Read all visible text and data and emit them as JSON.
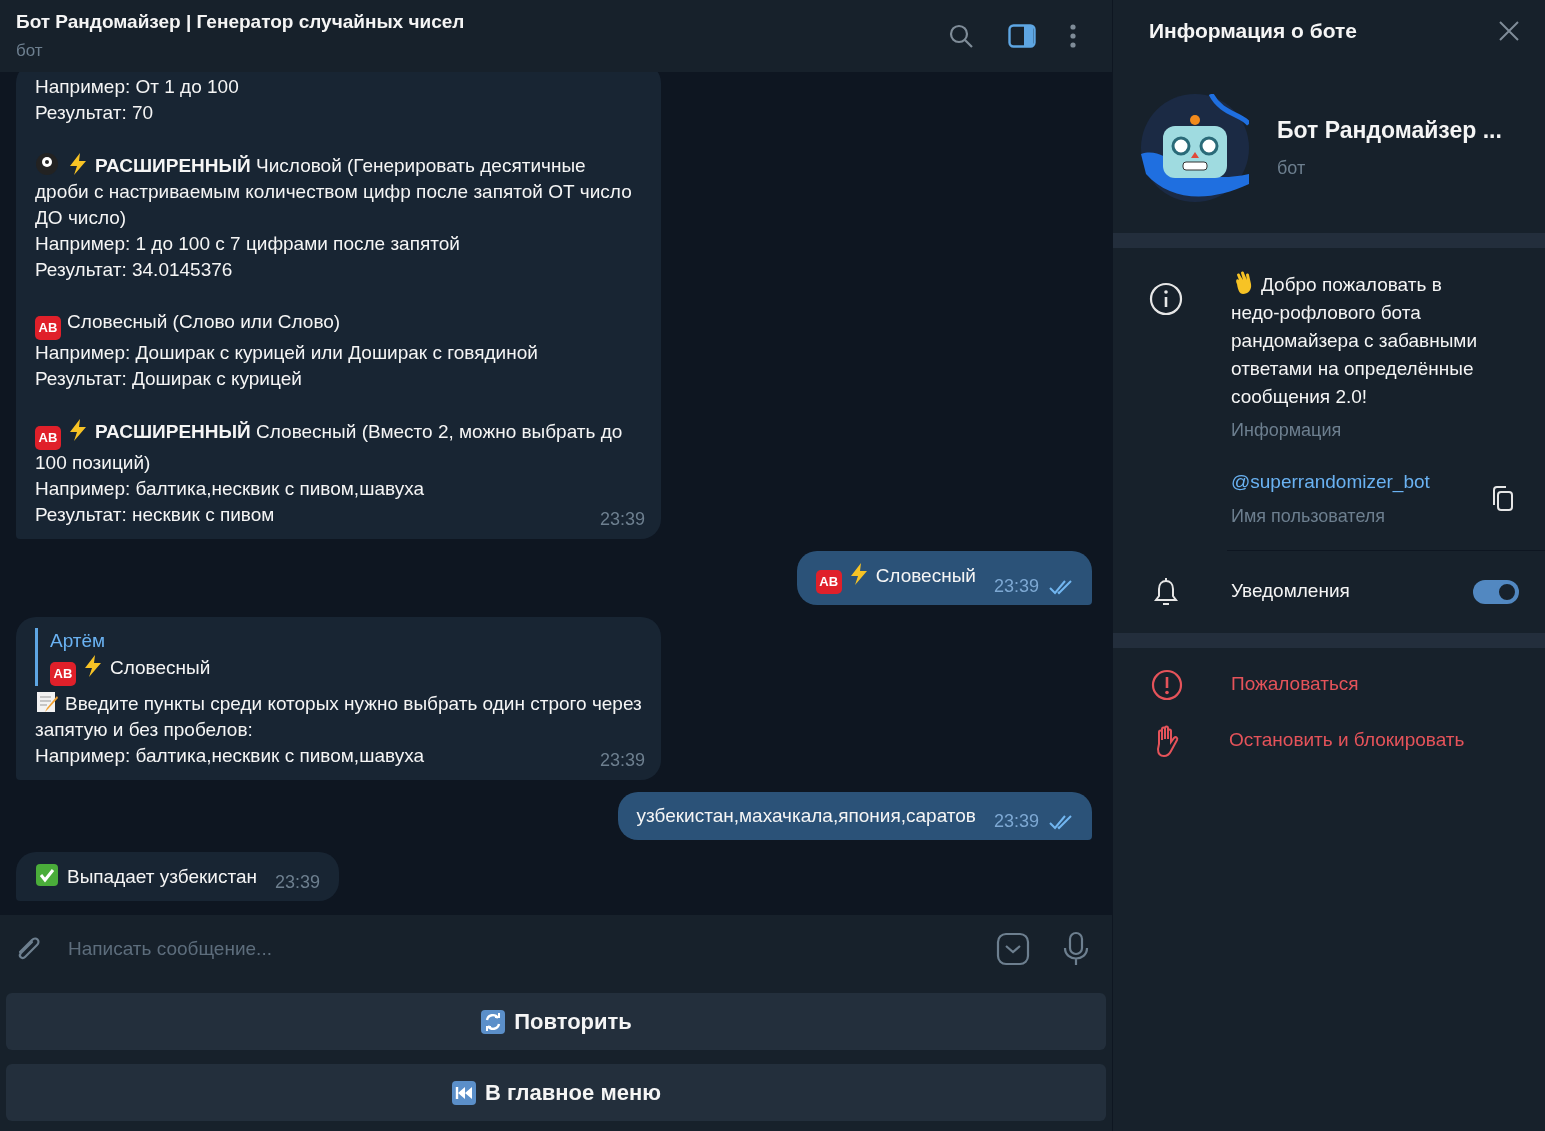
{
  "header": {
    "title": "Бот Рандомайзер | Генератор случайных чисел",
    "subtitle": "бот",
    "panel_button": {
      "selected": true
    }
  },
  "messages": [
    {
      "kind": "incoming",
      "time": "23:39",
      "paragraphs": [
        [
          {
            "text": "Например: От 1 до 100"
          },
          {
            "text": "Результат: 70"
          }
        ],
        [
          {
            "icons": [
              {
                "kind": "ball"
              },
              {
                "kind": "bolt"
              }
            ],
            "text": "**РАСШИРЕННЫЙ** Числовой (Генерировать десятичные дроби с настриваемым количеством цифр после запятой ОТ число ДО число)"
          },
          {
            "text": "Например: 1 до 100 с 7 цифрами после запятой"
          },
          {
            "text": "Результат: 34.0145376"
          }
        ],
        [
          {
            "icons": [
              {
                "kind": "badge",
                "label": "AB"
              }
            ],
            "text": "Словесный (Слово или Слово)"
          },
          {
            "text": "Например: Доширак с курицей или Доширак с говядиной"
          },
          {
            "text": "Результат: Доширак с курицей"
          }
        ],
        [
          {
            "icons": [
              {
                "kind": "badge",
                "label": "AB"
              },
              {
                "kind": "bolt"
              }
            ],
            "text": "**РАСШИРЕННЫЙ** Словесный (Вместо 2, можно выбрать до 100 позиций)"
          },
          {
            "text": "Например: балтика,несквик с пивом,шавуха"
          },
          {
            "text": "Результат: несквик с пивом"
          }
        ]
      ]
    },
    {
      "kind": "outgoing",
      "time": "23:39",
      "read": true,
      "paragraphs": [
        [
          {
            "icons": [
              {
                "kind": "badge",
                "label": "AB"
              },
              {
                "kind": "bolt"
              }
            ],
            "text": "Словесный"
          }
        ]
      ]
    },
    {
      "kind": "incoming",
      "time": "23:39",
      "reply": {
        "author": "Артём",
        "icons": [
          {
            "kind": "badge",
            "label": "AB"
          },
          {
            "kind": "bolt"
          }
        ],
        "text": "Словесный"
      },
      "paragraphs": [
        [
          {
            "icons": [
              {
                "kind": "memo"
              }
            ],
            "text": "Введите пункты среди которых нужно выбрать один строго через запятую и без пробелов:"
          },
          {
            "text": "Например: балтика,несквик с пивом,шавуха"
          }
        ]
      ]
    },
    {
      "kind": "outgoing",
      "time": "23:39",
      "read": true,
      "paragraphs": [
        [
          {
            "text": "узбекистан,махачкала,япония,саратов"
          }
        ]
      ]
    },
    {
      "kind": "incoming",
      "time": "23:39",
      "paragraphs": [
        [
          {
            "icons": [
              {
                "kind": "check"
              }
            ],
            "text": "Выпадает узбекистан"
          }
        ]
      ]
    }
  ],
  "composer": {
    "placeholder": "Написать сообщение..."
  },
  "keyboard": [
    {
      "kind": "repeat",
      "label": "Повторить"
    },
    {
      "kind": "rewind",
      "label": "В главное меню"
    }
  ],
  "info_panel": {
    "title": "Информация о боте",
    "name": "Бот Рандомайзер ...",
    "subtitle": "бот",
    "description": "Добро пожаловать в недо-рофлового бота рандомайзера с забавными ответами на определённые сообщения 2.0!",
    "description_label": "Информация",
    "username": "@superrandomizer_bot",
    "username_label": "Имя пользователя",
    "notifications": {
      "label": "Уведомления",
      "on": true
    },
    "actions": [
      {
        "kind": "alert",
        "label": "Пожаловаться"
      },
      {
        "kind": "hand",
        "label": "Остановить и блокировать"
      }
    ]
  }
}
